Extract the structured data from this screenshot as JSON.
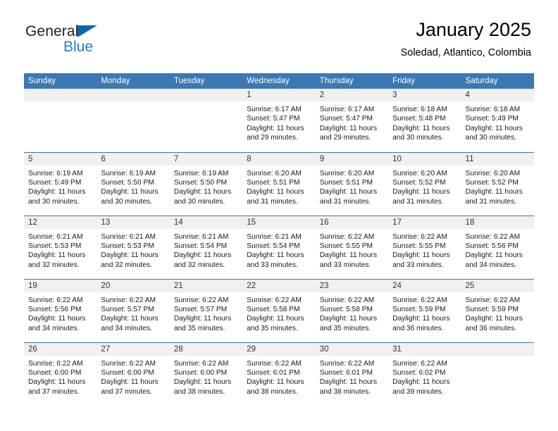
{
  "logo": {
    "word1": "General",
    "word2": "Blue",
    "triangle_color": "#0b66b1",
    "word2_color": "#1f7fd0"
  },
  "header": {
    "title": "January 2025",
    "subtitle": "Soledad, Atlantico, Colombia",
    "accent_color": "#3b78b5",
    "daynum_bg": "#f0f0f0"
  },
  "weekdays": [
    "Sunday",
    "Monday",
    "Tuesday",
    "Wednesday",
    "Thursday",
    "Friday",
    "Saturday"
  ],
  "labels": {
    "sunrise": "Sunrise:",
    "sunset": "Sunset:",
    "daylight": "Daylight:"
  },
  "weeks": [
    [
      {
        "day": "",
        "sunrise": "",
        "sunset": "",
        "daylight": ""
      },
      {
        "day": "",
        "sunrise": "",
        "sunset": "",
        "daylight": ""
      },
      {
        "day": "",
        "sunrise": "",
        "sunset": "",
        "daylight": ""
      },
      {
        "day": "1",
        "sunrise": "Sunrise: 6:17 AM",
        "sunset": "Sunset: 5:47 PM",
        "daylight": "Daylight: 11 hours and 29 minutes."
      },
      {
        "day": "2",
        "sunrise": "Sunrise: 6:17 AM",
        "sunset": "Sunset: 5:47 PM",
        "daylight": "Daylight: 11 hours and 29 minutes."
      },
      {
        "day": "3",
        "sunrise": "Sunrise: 6:18 AM",
        "sunset": "Sunset: 5:48 PM",
        "daylight": "Daylight: 11 hours and 30 minutes."
      },
      {
        "day": "4",
        "sunrise": "Sunrise: 6:18 AM",
        "sunset": "Sunset: 5:49 PM",
        "daylight": "Daylight: 11 hours and 30 minutes."
      }
    ],
    [
      {
        "day": "5",
        "sunrise": "Sunrise: 6:19 AM",
        "sunset": "Sunset: 5:49 PM",
        "daylight": "Daylight: 11 hours and 30 minutes."
      },
      {
        "day": "6",
        "sunrise": "Sunrise: 6:19 AM",
        "sunset": "Sunset: 5:50 PM",
        "daylight": "Daylight: 11 hours and 30 minutes."
      },
      {
        "day": "7",
        "sunrise": "Sunrise: 6:19 AM",
        "sunset": "Sunset: 5:50 PM",
        "daylight": "Daylight: 11 hours and 30 minutes."
      },
      {
        "day": "8",
        "sunrise": "Sunrise: 6:20 AM",
        "sunset": "Sunset: 5:51 PM",
        "daylight": "Daylight: 11 hours and 31 minutes."
      },
      {
        "day": "9",
        "sunrise": "Sunrise: 6:20 AM",
        "sunset": "Sunset: 5:51 PM",
        "daylight": "Daylight: 11 hours and 31 minutes."
      },
      {
        "day": "10",
        "sunrise": "Sunrise: 6:20 AM",
        "sunset": "Sunset: 5:52 PM",
        "daylight": "Daylight: 11 hours and 31 minutes."
      },
      {
        "day": "11",
        "sunrise": "Sunrise: 6:20 AM",
        "sunset": "Sunset: 5:52 PM",
        "daylight": "Daylight: 11 hours and 31 minutes."
      }
    ],
    [
      {
        "day": "12",
        "sunrise": "Sunrise: 6:21 AM",
        "sunset": "Sunset: 5:53 PM",
        "daylight": "Daylight: 11 hours and 32 minutes."
      },
      {
        "day": "13",
        "sunrise": "Sunrise: 6:21 AM",
        "sunset": "Sunset: 5:53 PM",
        "daylight": "Daylight: 11 hours and 32 minutes."
      },
      {
        "day": "14",
        "sunrise": "Sunrise: 6:21 AM",
        "sunset": "Sunset: 5:54 PM",
        "daylight": "Daylight: 11 hours and 32 minutes."
      },
      {
        "day": "15",
        "sunrise": "Sunrise: 6:21 AM",
        "sunset": "Sunset: 5:54 PM",
        "daylight": "Daylight: 11 hours and 33 minutes."
      },
      {
        "day": "16",
        "sunrise": "Sunrise: 6:22 AM",
        "sunset": "Sunset: 5:55 PM",
        "daylight": "Daylight: 11 hours and 33 minutes."
      },
      {
        "day": "17",
        "sunrise": "Sunrise: 6:22 AM",
        "sunset": "Sunset: 5:55 PM",
        "daylight": "Daylight: 11 hours and 33 minutes."
      },
      {
        "day": "18",
        "sunrise": "Sunrise: 6:22 AM",
        "sunset": "Sunset: 5:56 PM",
        "daylight": "Daylight: 11 hours and 34 minutes."
      }
    ],
    [
      {
        "day": "19",
        "sunrise": "Sunrise: 6:22 AM",
        "sunset": "Sunset: 5:56 PM",
        "daylight": "Daylight: 11 hours and 34 minutes."
      },
      {
        "day": "20",
        "sunrise": "Sunrise: 6:22 AM",
        "sunset": "Sunset: 5:57 PM",
        "daylight": "Daylight: 11 hours and 34 minutes."
      },
      {
        "day": "21",
        "sunrise": "Sunrise: 6:22 AM",
        "sunset": "Sunset: 5:57 PM",
        "daylight": "Daylight: 11 hours and 35 minutes."
      },
      {
        "day": "22",
        "sunrise": "Sunrise: 6:22 AM",
        "sunset": "Sunset: 5:58 PM",
        "daylight": "Daylight: 11 hours and 35 minutes."
      },
      {
        "day": "23",
        "sunrise": "Sunrise: 6:22 AM",
        "sunset": "Sunset: 5:58 PM",
        "daylight": "Daylight: 11 hours and 35 minutes."
      },
      {
        "day": "24",
        "sunrise": "Sunrise: 6:22 AM",
        "sunset": "Sunset: 5:59 PM",
        "daylight": "Daylight: 11 hours and 36 minutes."
      },
      {
        "day": "25",
        "sunrise": "Sunrise: 6:22 AM",
        "sunset": "Sunset: 5:59 PM",
        "daylight": "Daylight: 11 hours and 36 minutes."
      }
    ],
    [
      {
        "day": "26",
        "sunrise": "Sunrise: 6:22 AM",
        "sunset": "Sunset: 6:00 PM",
        "daylight": "Daylight: 11 hours and 37 minutes."
      },
      {
        "day": "27",
        "sunrise": "Sunrise: 6:22 AM",
        "sunset": "Sunset: 6:00 PM",
        "daylight": "Daylight: 11 hours and 37 minutes."
      },
      {
        "day": "28",
        "sunrise": "Sunrise: 6:22 AM",
        "sunset": "Sunset: 6:00 PM",
        "daylight": "Daylight: 11 hours and 38 minutes."
      },
      {
        "day": "29",
        "sunrise": "Sunrise: 6:22 AM",
        "sunset": "Sunset: 6:01 PM",
        "daylight": "Daylight: 11 hours and 38 minutes."
      },
      {
        "day": "30",
        "sunrise": "Sunrise: 6:22 AM",
        "sunset": "Sunset: 6:01 PM",
        "daylight": "Daylight: 11 hours and 38 minutes."
      },
      {
        "day": "31",
        "sunrise": "Sunrise: 6:22 AM",
        "sunset": "Sunset: 6:02 PM",
        "daylight": "Daylight: 11 hours and 39 minutes."
      },
      {
        "day": "",
        "sunrise": "",
        "sunset": "",
        "daylight": ""
      }
    ]
  ]
}
